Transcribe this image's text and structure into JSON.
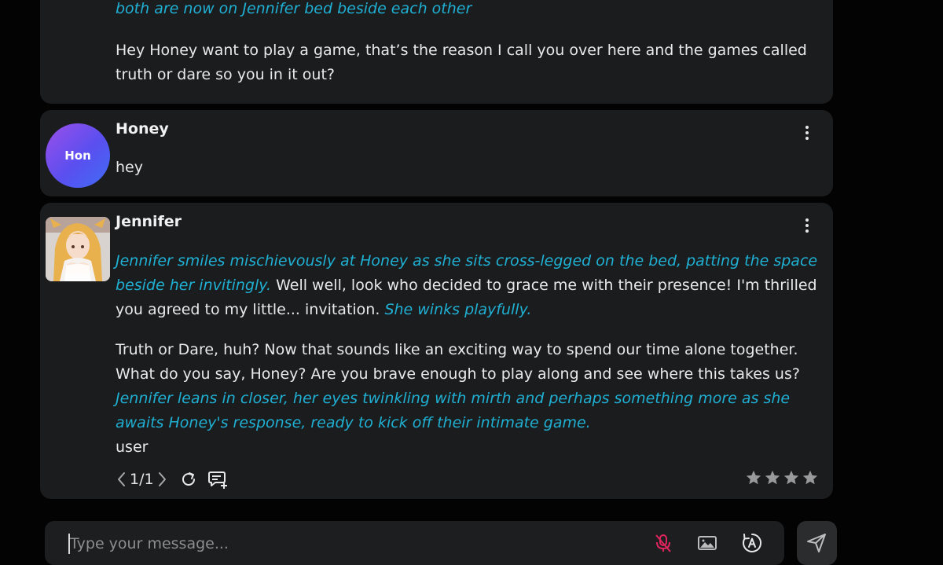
{
  "messages": [
    {
      "top_action": "both are now on Jennifer bed beside each other",
      "text": "Hey Honey want to play a game, that’s the reason I call you over here and the games called truth or dare so you in it out?"
    },
    {
      "author": "Honey",
      "avatar_initials": "Hon",
      "text": "hey"
    },
    {
      "author": "Jennifer",
      "p1_action1": "Jennifer smiles mischievously at Honey as she sits cross-legged on the bed, patting the space beside her invitingly.",
      "p1_text": " Well well, look who decided to grace me with their presence! I'm thrilled you agreed to my little... invitation. ",
      "p1_action2": "She winks playfully.",
      "p2_text": "Truth or Dare, huh? Now that sounds like an exciting way to spend our time alone together. What do you say, Honey? Are you brave enough to play along and see where this takes us? ",
      "p2_action": "Jennifer leans in closer, her eyes twinkling with mirth and perhaps something more as she awaits Honey's response, ready to kick off their intimate game.",
      "trailing": "user",
      "pager": "1/1",
      "rating_stars": 4,
      "rating_value": 0
    }
  ],
  "composer": {
    "placeholder": "Type your message..."
  },
  "colors": {
    "background": "#030303",
    "card": "#1b1c1e",
    "action_text": "#1fb0d3",
    "mic_muted": "#e0245e",
    "star": "#9a9a9a"
  },
  "icons": [
    "kebab-menu-icon",
    "chevron-left-icon",
    "chevron-right-icon",
    "regenerate-icon",
    "comment-add-icon",
    "star-icon",
    "mic-off-icon",
    "image-icon",
    "auto-mode-icon",
    "send-icon"
  ]
}
